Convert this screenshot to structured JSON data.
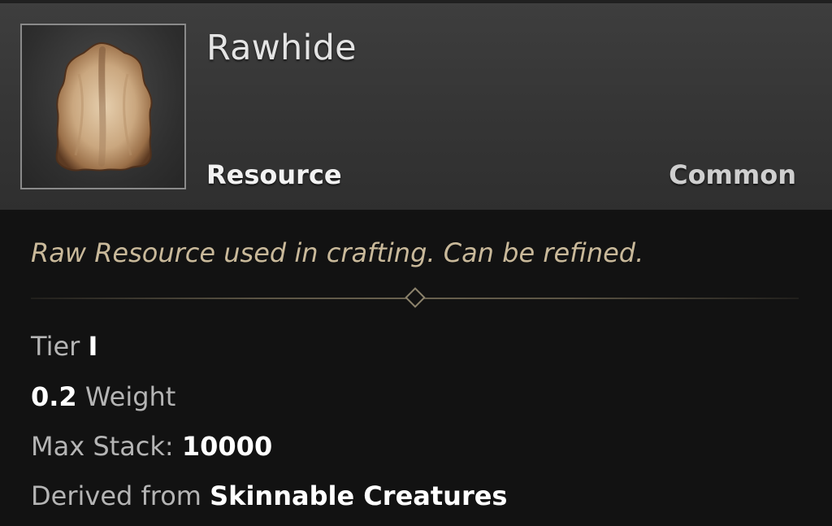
{
  "item": {
    "name": "Rawhide",
    "type": "Resource",
    "rarity": "Common",
    "icon": "rawhide-pelt-icon",
    "description": "Raw Resource used in crafting. Can be refined."
  },
  "stats": {
    "tier_label": "Tier",
    "tier_value": "I",
    "weight_value": "0.2",
    "weight_label": "Weight",
    "stack_label": "Max Stack:",
    "stack_value": "10000",
    "derived_label": "Derived from",
    "derived_value": "Skinnable Creatures"
  },
  "colors": {
    "header_bg": "#3a3a3a",
    "body_bg": "#121212",
    "description": "#c9b99a",
    "divider": "#6a624f"
  }
}
